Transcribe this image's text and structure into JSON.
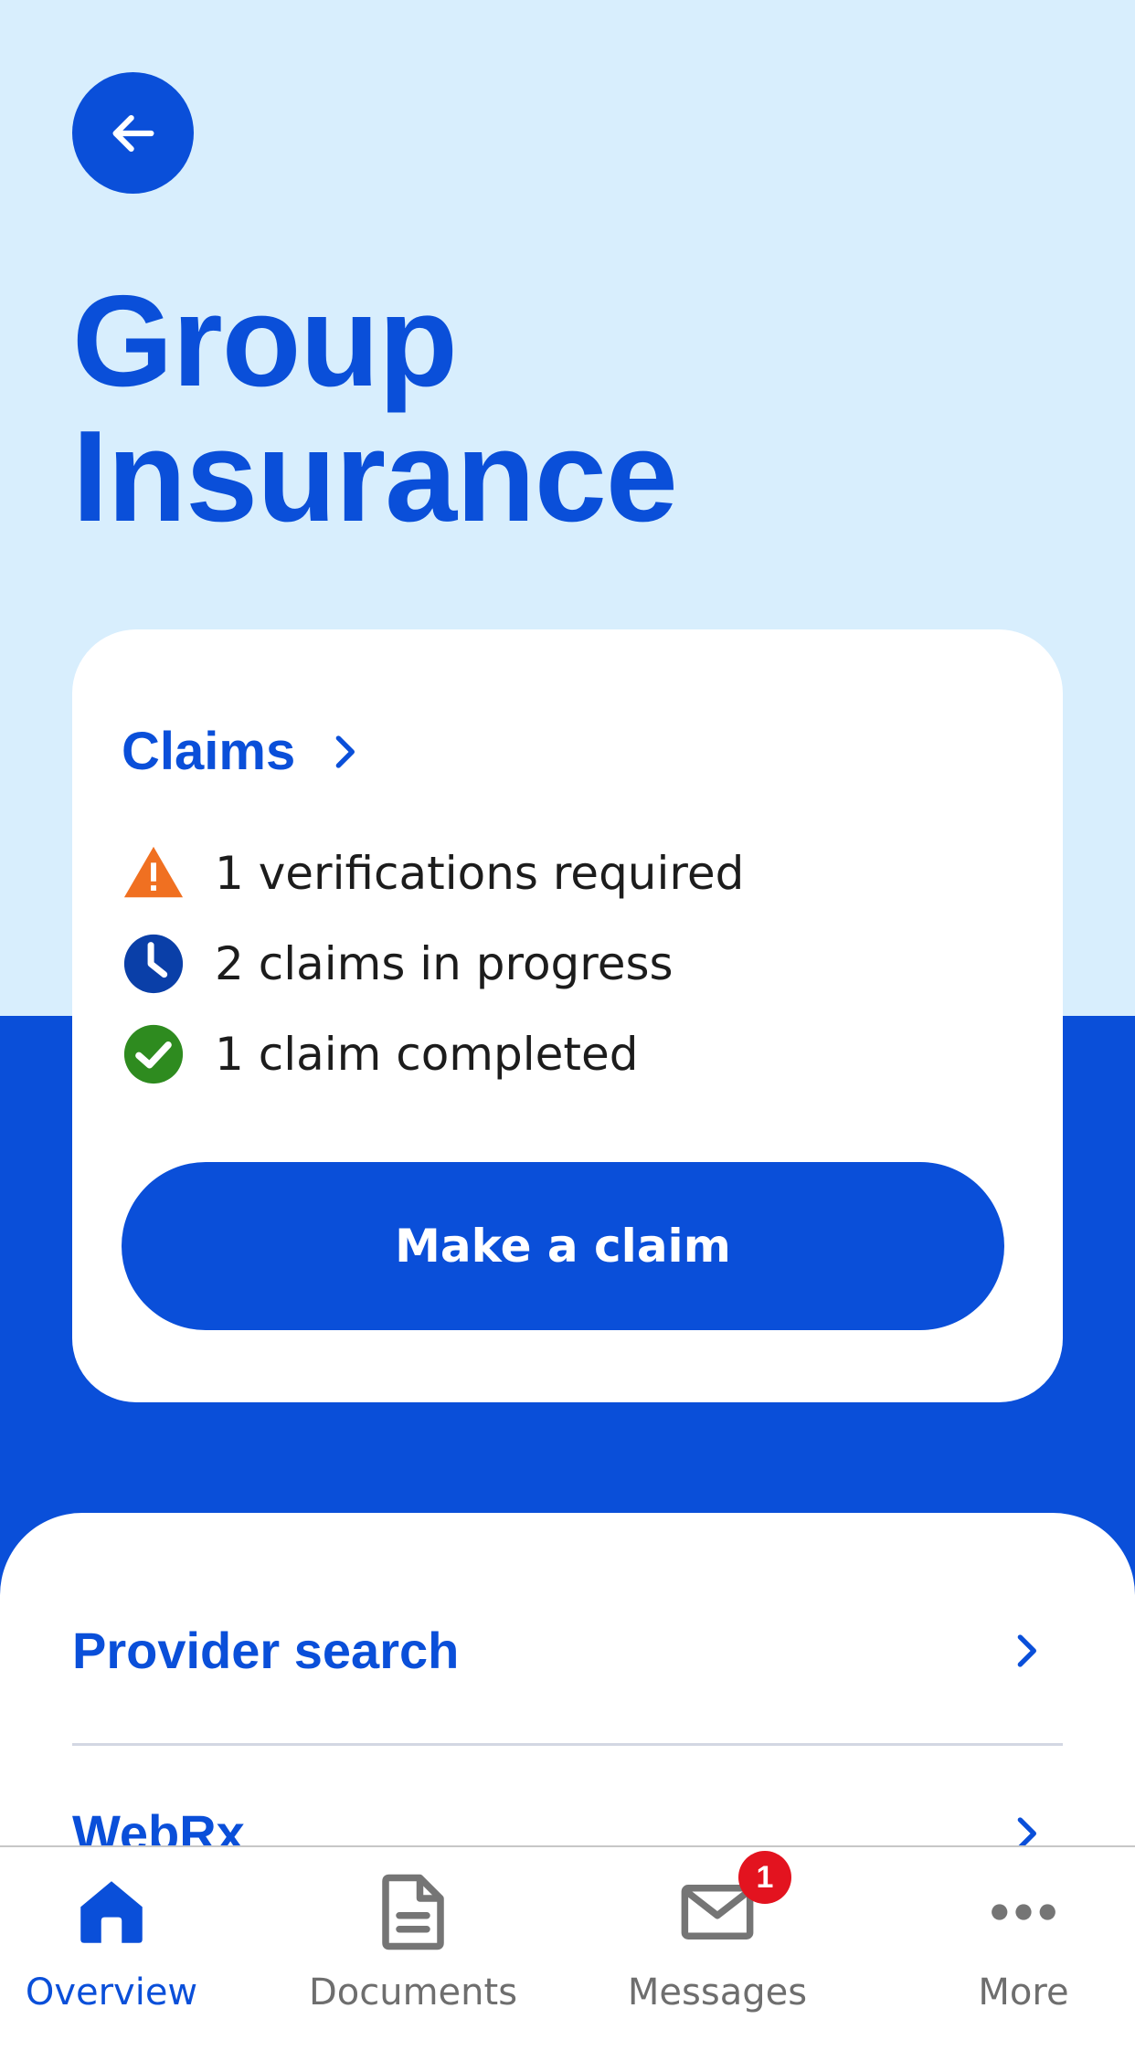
{
  "header": {
    "back_icon": "arrow-left-icon",
    "title_line1": "Group",
    "title_line2": "Insurance"
  },
  "claims": {
    "title": "Claims",
    "items": [
      {
        "icon": "warning-icon",
        "text": "1 verifications required",
        "color": "#f07021"
      },
      {
        "icon": "clock-icon",
        "text": "2 claims in progress",
        "color": "#0a3fa8"
      },
      {
        "icon": "check-circle-icon",
        "text": "1 claim completed",
        "color": "#2e8b1f"
      }
    ],
    "button_label": "Make a claim"
  },
  "links": [
    {
      "label": "Provider search"
    },
    {
      "label": "WebRx"
    }
  ],
  "tabs": [
    {
      "label": "Overview",
      "icon": "home-icon",
      "active": true
    },
    {
      "label": "Documents",
      "icon": "document-icon"
    },
    {
      "label": "Messages",
      "icon": "mail-icon",
      "badge": "1"
    },
    {
      "label": "More",
      "icon": "more-icon"
    }
  ],
  "colors": {
    "brand_blue": "#0a4fd9",
    "light_bg": "#d8eefd",
    "badge_red": "#e3131f"
  }
}
